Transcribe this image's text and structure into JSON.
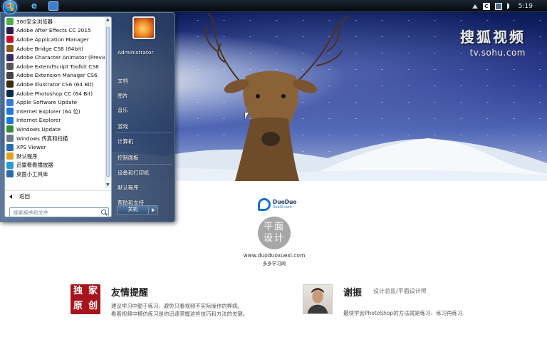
{
  "taskbar": {
    "clock": "5:19",
    "tray_icons": [
      "flag-icon",
      "c-icon",
      "network-icon",
      "speaker-icon"
    ],
    "tray_c_label": "C",
    "pinned": [
      "ie-icon",
      "app-window-icon"
    ]
  },
  "watermark": {
    "brand": "搜狐视频",
    "url": "tv.sohu.com"
  },
  "start_menu": {
    "programs": [
      {
        "label": "360安全浏览器",
        "icon": "360-browser-icon",
        "color": "#4caf50"
      },
      {
        "label": "Adobe After Effects CC 2015",
        "icon": "ae-icon",
        "color": "#2b1a4a"
      },
      {
        "label": "Adobe Application Manager",
        "icon": "adobe-icon",
        "color": "#c8102e"
      },
      {
        "label": "Adobe Bridge CS6 (64bit)",
        "icon": "br-icon",
        "color": "#8a5a1c"
      },
      {
        "label": "Adobe Character Animator (Preview",
        "icon": "ch-icon",
        "color": "#3b2a64"
      },
      {
        "label": "Adobe ExtendScript Toolkit CS6",
        "icon": "es-icon",
        "color": "#555555"
      },
      {
        "label": "Adobe Extension Manager CS6",
        "icon": "em-icon",
        "color": "#444444"
      },
      {
        "label": "Adobe Illustrator CS6 (64 Bit)",
        "icon": "ai-icon",
        "color": "#3a2a10"
      },
      {
        "label": "Adobe Photoshop CC (64 Bit)",
        "icon": "ps-icon",
        "color": "#0b2a4a"
      },
      {
        "label": "Apple Software Update",
        "icon": "apple-update-icon",
        "color": "#3a7ad0"
      },
      {
        "label": "Internet Explorer (64 位)",
        "icon": "ie-icon",
        "color": "#1e7ad6"
      },
      {
        "label": "Internet Explorer",
        "icon": "ie-icon",
        "color": "#1e7ad6"
      },
      {
        "label": "Windows Update",
        "icon": "windows-update-icon",
        "color": "#3a8a3a"
      },
      {
        "label": "Windows 传真和扫描",
        "icon": "fax-icon",
        "color": "#6a7a8a"
      },
      {
        "label": "XPS Viewer",
        "icon": "xps-icon",
        "color": "#2a6ab0"
      },
      {
        "label": "默认程序",
        "icon": "default-programs-icon",
        "color": "#e0a020"
      },
      {
        "label": "迅雷看看播放器",
        "icon": "xunlei-icon",
        "color": "#2a9ad0"
      },
      {
        "label": "桌面小工具库",
        "icon": "gadgets-icon",
        "color": "#2a6ab0"
      }
    ],
    "back_label": "返回",
    "search_placeholder": "搜索程序和文件",
    "user": "Administrator",
    "right_items": [
      "文档",
      "图片",
      "音乐",
      "游戏",
      "计算机",
      "控制面板",
      "设备和打印机",
      "默认程序",
      "帮助和支持"
    ],
    "shutdown_label": "关机"
  },
  "content": {
    "logo_name": "DuoDuo",
    "logo_sub": "XueXi.com",
    "badge_line1": "平面",
    "badge_line2": "设计",
    "site_url": "www.duoduoxuexi.com",
    "site_name": "多多学习网",
    "exclusive": [
      "独",
      "家",
      "原",
      "创"
    ],
    "tip_title": "友情提醒",
    "tip_line1": "建议学习中勤于练习，避免只看视频不实际操作的弊病。",
    "tip_line2": "看着视频中模仿练习是你迅速掌握这些技巧和方法的关键。",
    "author_name": "谢振",
    "author_role": "设计总监/平面设计师",
    "author_quote": "最快学会PhotoShop的方法就是练习、练习再练习"
  }
}
